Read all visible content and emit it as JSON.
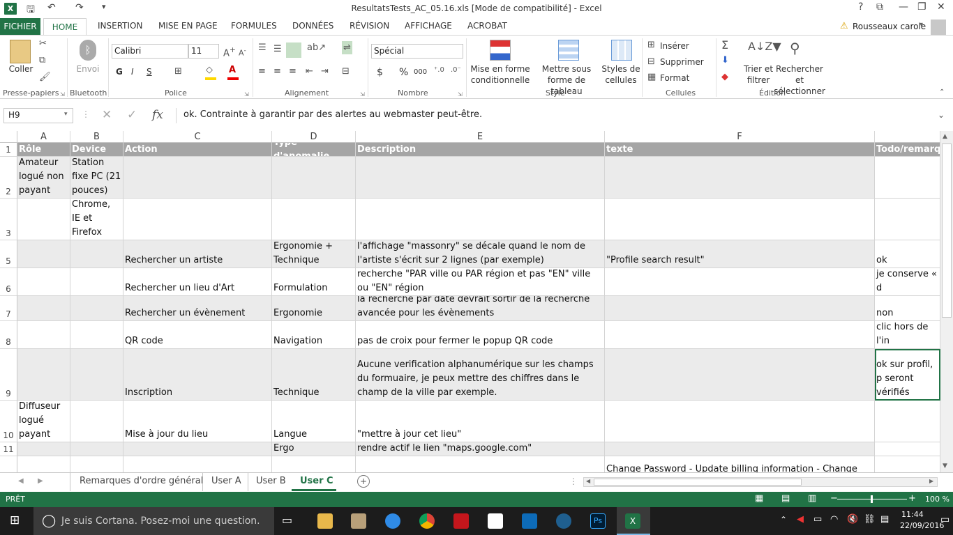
{
  "window": {
    "title": "ResultatsTests_AC_05.16.xls  [Mode de compatibilité] - Excel",
    "help": "?",
    "user": "Rousseaux carole"
  },
  "tabs": [
    "FICHIER",
    "HOME",
    "INSERTION",
    "MISE EN PAGE",
    "FORMULES",
    "DONNÉES",
    "RÉVISION",
    "AFFICHAGE",
    "ACROBAT"
  ],
  "ribbon": {
    "clipboard": {
      "paste": "Coller",
      "label": "Presse-papiers"
    },
    "bluetooth": {
      "send": "Envoi",
      "label": "Bluetooth"
    },
    "font": {
      "name": "Calibri",
      "size": "11",
      "bold": "G",
      "italic": "I",
      "underline": "S",
      "label": "Police"
    },
    "alignment": {
      "label": "Alignement"
    },
    "number": {
      "format": "Spécial",
      "label": "Nombre",
      "currency": "$",
      "percent": "%",
      "thousands": "000"
    },
    "styles": {
      "conditional": "Mise en forme conditionnelle",
      "table": "Mettre sous forme de tableau",
      "cell_styles": "Styles de cellules",
      "label": "Style"
    },
    "cells": {
      "insert": "Insérer",
      "delete": "Supprimer",
      "format": "Format",
      "label": "Cellules"
    },
    "editing": {
      "sort": "Trier et filtrer",
      "find": "Rechercher et sélectionner",
      "label": "Édition"
    }
  },
  "formula_bar": {
    "name_box": "H9",
    "formula": "ok. Contrainte à garantir par des alertes au webmaster peut-être.",
    "fx": "fx"
  },
  "columns": [
    "A",
    "B",
    "C",
    "D",
    "E",
    "F"
  ],
  "header_row": {
    "num": "1",
    "cells": [
      "Rôle",
      "Device",
      "Action",
      "Type d'anomalie",
      "Description",
      "texte",
      "Todo/remarque"
    ]
  },
  "rows": [
    {
      "num": "2",
      "cells": [
        "Amateur logué non payant",
        "Station fixe PC (21 pouces)",
        "",
        "",
        "",
        "",
        ""
      ]
    },
    {
      "num": "3",
      "cells": [
        "",
        "Navigateur Chrome, IE et Firefox",
        "",
        "",
        "",
        "",
        ""
      ]
    },
    {
      "num": "5",
      "cells": [
        "",
        "",
        "Rechercher un artiste",
        "Ergonomie + Technique",
        "l'affichage \"massonry\" se décale quand le nom de l'artiste s'écrit sur 2 lignes (par exemple)",
        "\"Profile search result\"",
        "ok"
      ]
    },
    {
      "num": "6",
      "cells": [
        "",
        "",
        "Rechercher un lieu d'Art",
        "Formulation",
        "recherche \"PAR ville ou PAR région et pas \"EN\" ville ou \"EN\" région",
        "",
        "je conserve « d"
      ]
    },
    {
      "num": "7",
      "cells": [
        "",
        "",
        "Rechercher un évènement",
        "Ergonomie",
        "la recherche par date devrait sortir de la recherche avancée pour les évènements",
        "",
        "non"
      ]
    },
    {
      "num": "8",
      "cells": [
        "",
        "",
        "QR code",
        "Navigation",
        "pas de croix pour fermer le popup QR code",
        "",
        "clic hors de l'in"
      ]
    },
    {
      "num": "9",
      "cells": [
        "",
        "",
        "Inscription",
        "Technique",
        "Aucune verification alphanumérique sur les champs du formuaire, je peux mettre des chiffres dans le champ de la ville par exemple.",
        "",
        "ok sur profil, p seront vérifiés"
      ]
    },
    {
      "num": "10",
      "cells": [
        "Diffuseur logué payant",
        "",
        "Mise à jour du lieu",
        "Langue",
        "\"mettre à jour cet lieu\"",
        "",
        ""
      ]
    },
    {
      "num": "11",
      "cells": [
        "",
        "",
        "",
        "Ergo",
        "rendre actif le lien \"maps.google.com\"",
        "",
        ""
      ]
    },
    {
      "num": "",
      "cells": [
        "",
        "",
        "",
        "",
        "",
        "Change Password - Update billing information - Change",
        ""
      ]
    }
  ],
  "sheets": [
    "Remarques d'ordre général",
    "User A",
    "User B",
    "User C"
  ],
  "status": {
    "ready": "PRÊT",
    "zoom": "100 %"
  },
  "taskbar": {
    "search": "Je suis Cortana. Posez-moi une question.",
    "time": "11:44",
    "date": "22/09/2016"
  }
}
